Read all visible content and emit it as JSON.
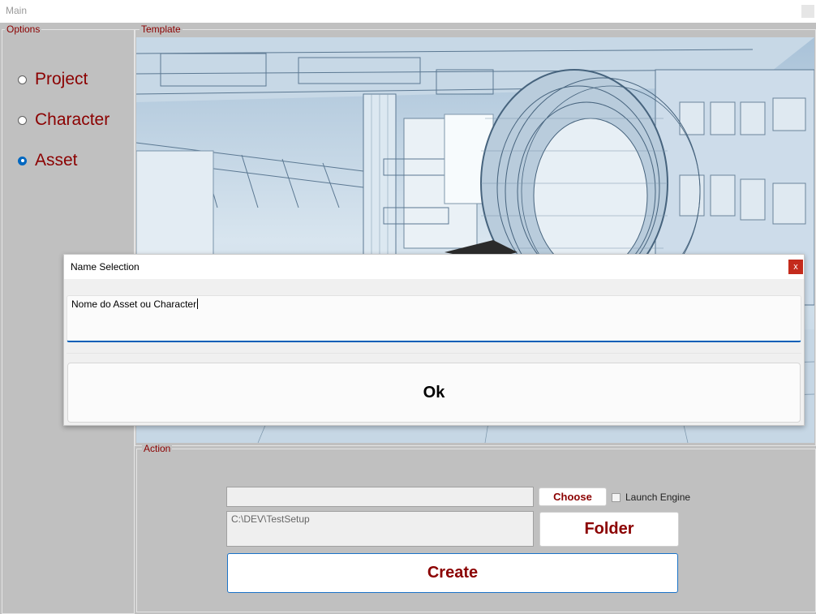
{
  "window": {
    "title": "Main"
  },
  "options": {
    "legend": "Options",
    "items": [
      {
        "label": "Project",
        "checked": false
      },
      {
        "label": "Character",
        "checked": false
      },
      {
        "label": "Asset",
        "checked": true
      }
    ]
  },
  "template": {
    "legend": "Template",
    "image_description_icon": "wireframe-image"
  },
  "action": {
    "legend": "Action",
    "file_input": {
      "value": "",
      "placeholder": ""
    },
    "choose_label": "Choose",
    "launch_engine_label": "Launch Engine",
    "launch_engine_checked": false,
    "path_value": "C:\\DEV\\TestSetup",
    "folder_label": "Folder",
    "create_label": "Create"
  },
  "dialog": {
    "title": "Name Selection",
    "close_label": "x",
    "input_value": "Nome do Asset ou Character",
    "ok_label": "Ok"
  },
  "colors": {
    "accent_text": "#8b0000",
    "focus_blue": "#005fb8",
    "close_red": "#c42b1c"
  }
}
